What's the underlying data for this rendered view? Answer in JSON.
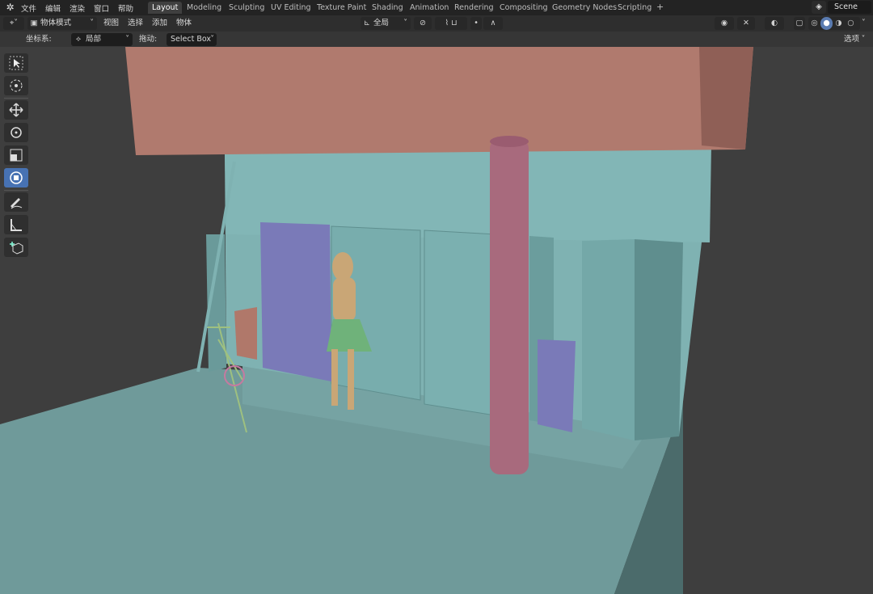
{
  "menu": [
    "文件",
    "编辑",
    "渲染",
    "窗口",
    "帮助"
  ],
  "workspace_tabs": [
    "Layout",
    "Modeling",
    "Sculpting",
    "UV Editing",
    "Texture Paint",
    "Shading",
    "Animation",
    "Rendering",
    "Compositing",
    "Geometry Nodes",
    "Scripting"
  ],
  "active_tab": "Layout",
  "scene_name": "Scene",
  "header": {
    "mode": "物体模式",
    "menus": [
      "视图",
      "选择",
      "添加",
      "物体"
    ],
    "transform_orientation": "全局"
  },
  "tool_settings": {
    "coord_label": "坐标系:",
    "coord_value": "局部",
    "drag_label": "拖动:",
    "drag_value": "Select Box",
    "options": "选项"
  },
  "tools": [
    "select-box-tool",
    "cursor-tool",
    "move-tool",
    "rotate-tool",
    "scale-tool",
    "transform-tool",
    "annotate-tool",
    "measure-tool",
    "add-cube-tool"
  ],
  "active_tool": "transform-tool",
  "colors": {
    "accent": "#4772b3",
    "wall": "#7fb3b3",
    "ceiling": "#b07a6e",
    "pillar": "#a86a7d",
    "purple_blocks": "#7a7ab8",
    "skin": "#c9a676",
    "skirt": "#6fb27a"
  }
}
